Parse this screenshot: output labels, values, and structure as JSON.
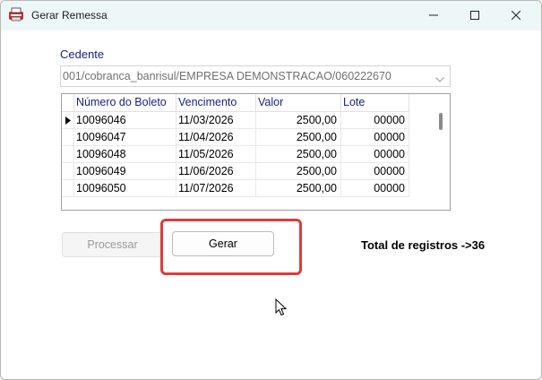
{
  "window": {
    "title": "Gerar Remessa",
    "icon": "printer-icon"
  },
  "cedente": {
    "label": "Cedente",
    "selected_value": "001/cobranca_banrisul/EMPRESA DEMONSTRACAO/060222670"
  },
  "grid": {
    "columns": [
      "Número do Boleto",
      "Vencimento",
      "Valor",
      "Lote"
    ],
    "rows": [
      [
        "10096046",
        "11/03/2026",
        "2500,00",
        "00000"
      ],
      [
        "10096047",
        "11/04/2026",
        "2500,00",
        "00000"
      ],
      [
        "10096048",
        "11/05/2026",
        "2500,00",
        "00000"
      ],
      [
        "10096049",
        "11/06/2026",
        "2500,00",
        "00000"
      ],
      [
        "10096050",
        "11/07/2026",
        "2500,00",
        "00000"
      ]
    ],
    "current_row_index": 0
  },
  "buttons": {
    "processar": "Processar",
    "gerar": "Gerar"
  },
  "status": {
    "total_text": "Total de registros ->36"
  },
  "colors": {
    "label_blue": "#1a237e",
    "highlight_red": "#e03a3a",
    "titlebar_bg": "#eef7f7"
  }
}
